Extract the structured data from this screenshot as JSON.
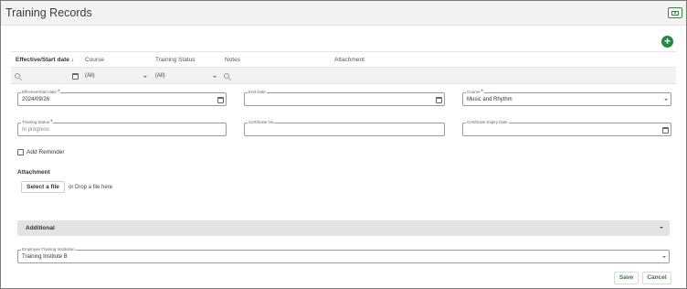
{
  "page": {
    "title": "Training Records"
  },
  "columns": [
    "Effective/Start date",
    "Course",
    "Training Status",
    "Notes",
    "Attachment"
  ],
  "filters": {
    "course": "(All)",
    "training_status": "(All)"
  },
  "form": {
    "effective_start_date": {
      "label": "Effective/Start date",
      "required": "*",
      "value": "2024/09/26"
    },
    "end_date": {
      "label": "End Date",
      "value": ""
    },
    "course": {
      "label": "Course",
      "required": "*",
      "value": "Music and Rhythm"
    },
    "training_status": {
      "label": "Training Status",
      "required": "*",
      "value": "In progress"
    },
    "certificate_no": {
      "label": "Certificate No",
      "value": ""
    },
    "certificate_expiry_date": {
      "label": "Certificate Expiry Date",
      "value": ""
    },
    "add_reminder": {
      "label": "Add Reminder"
    },
    "attachment": {
      "label": "Attachment",
      "select_button": "Select a file",
      "drop_text": "or Drop a file here"
    },
    "additional": {
      "label": "Additional"
    },
    "employee_training_institution": {
      "label": "Employee Training Institution",
      "value": "Training Institute B"
    }
  },
  "actions": {
    "save": "Save",
    "cancel": "Cancel"
  },
  "colors": {
    "accent": "#1e8e3e",
    "required": "#dd0000"
  }
}
